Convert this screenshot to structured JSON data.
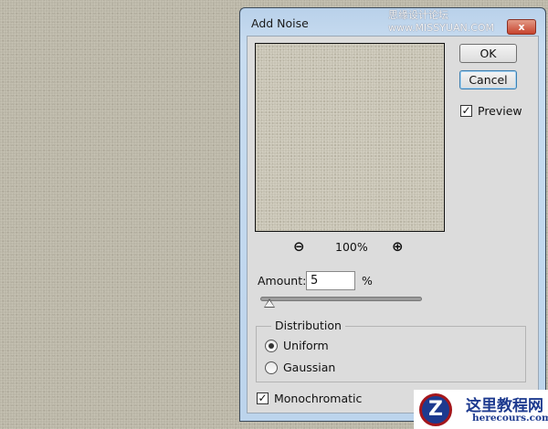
{
  "dialog": {
    "title": "Add Noise",
    "close_label": "x"
  },
  "buttons": {
    "ok": "OK",
    "cancel": "Cancel"
  },
  "preview_checkbox": {
    "label": "Preview",
    "checked": true
  },
  "zoom": {
    "level": "100%",
    "zoom_out_icon": "zoom-out-icon",
    "zoom_in_icon": "zoom-in-icon"
  },
  "amount": {
    "label": "Amount:",
    "value": "5",
    "unit": "%",
    "slider_fraction": 0.05
  },
  "distribution": {
    "label": "Distribution",
    "options": [
      {
        "label": "Uniform",
        "selected": true
      },
      {
        "label": "Gaussian",
        "selected": false
      }
    ]
  },
  "monochromatic": {
    "label": "Monochromatic",
    "checked": true
  },
  "watermarks": {
    "top": "思缘设计论坛 www.MISSYUAN.COM",
    "brand": "这里教程网",
    "url": "herecours.com"
  }
}
